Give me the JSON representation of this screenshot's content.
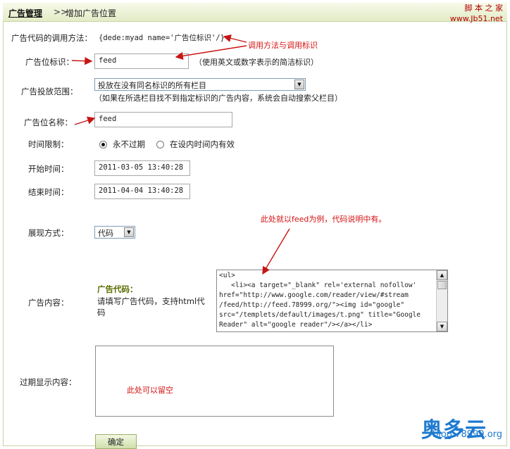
{
  "breadcrumb": {
    "section": "广告管理",
    "separator": ">>",
    "current": "增加广告位置"
  },
  "watermark_top": {
    "line1": "脚 本 之 家",
    "line2": "www.Jb51.net"
  },
  "call_method": {
    "label": "广告代码的调用方法：",
    "value": "{dede:myad name='广告位标识'/}"
  },
  "ad_tag": {
    "label": "广告位标识：",
    "value": "feed",
    "hint": "（使用英文或数字表示的简洁标识）"
  },
  "scope": {
    "label": "广告投放范围：",
    "selected": "投放在没有同名标识的所有栏目",
    "hint": "（如果在所选栏目找不到指定标识的广告内容，系统会自动搜索父栏目）"
  },
  "ad_name": {
    "label": "广告位名称：",
    "value": "feed"
  },
  "time_limit": {
    "label": "时间限制：",
    "options": [
      {
        "label": "永不过期",
        "checked": true
      },
      {
        "label": "在设内时间内有效",
        "checked": false
      }
    ]
  },
  "start_time": {
    "label": "开始时间：",
    "value": "2011-03-05 13:40:28"
  },
  "end_time": {
    "label": "结束时间：",
    "value": "2011-04-04 13:40:28"
  },
  "display_mode": {
    "label": "展现方式：",
    "selected": "代码"
  },
  "ad_content": {
    "label": "广告内容：",
    "code_title": "广告代码：",
    "code_hint": "请填写广告代码，支持html代码",
    "code_lines": [
      "<ul>",
      "   <li><a target=\"_blank\" rel='external nofollow'",
      "href=\"http://www.google.com/reader/view/#stream",
      "/feed/http://feed.78999.org/\"><img id=\"google\"",
      "src=\"/templets/default/images/t.png\" title=\"Google",
      "Reader\" alt=\"google reader\"/></a></li>"
    ]
  },
  "expire_content": {
    "label": "过期显示内容：",
    "value": ""
  },
  "submit_label": "确定",
  "annotations": {
    "call_method_note": "调用方法与调用标识",
    "example_note": "此处就以feed为例，代码说明中有。",
    "empty_note": "此处可以留空"
  },
  "watermark_bottom": {
    "brand": "奥多云",
    "site": "blog.78999.org"
  },
  "colors": {
    "annotation_red": "#d51111",
    "arrow_red": "#c81414",
    "header_green": "#e3ebc6",
    "code_title_olive": "#5b6b00"
  }
}
